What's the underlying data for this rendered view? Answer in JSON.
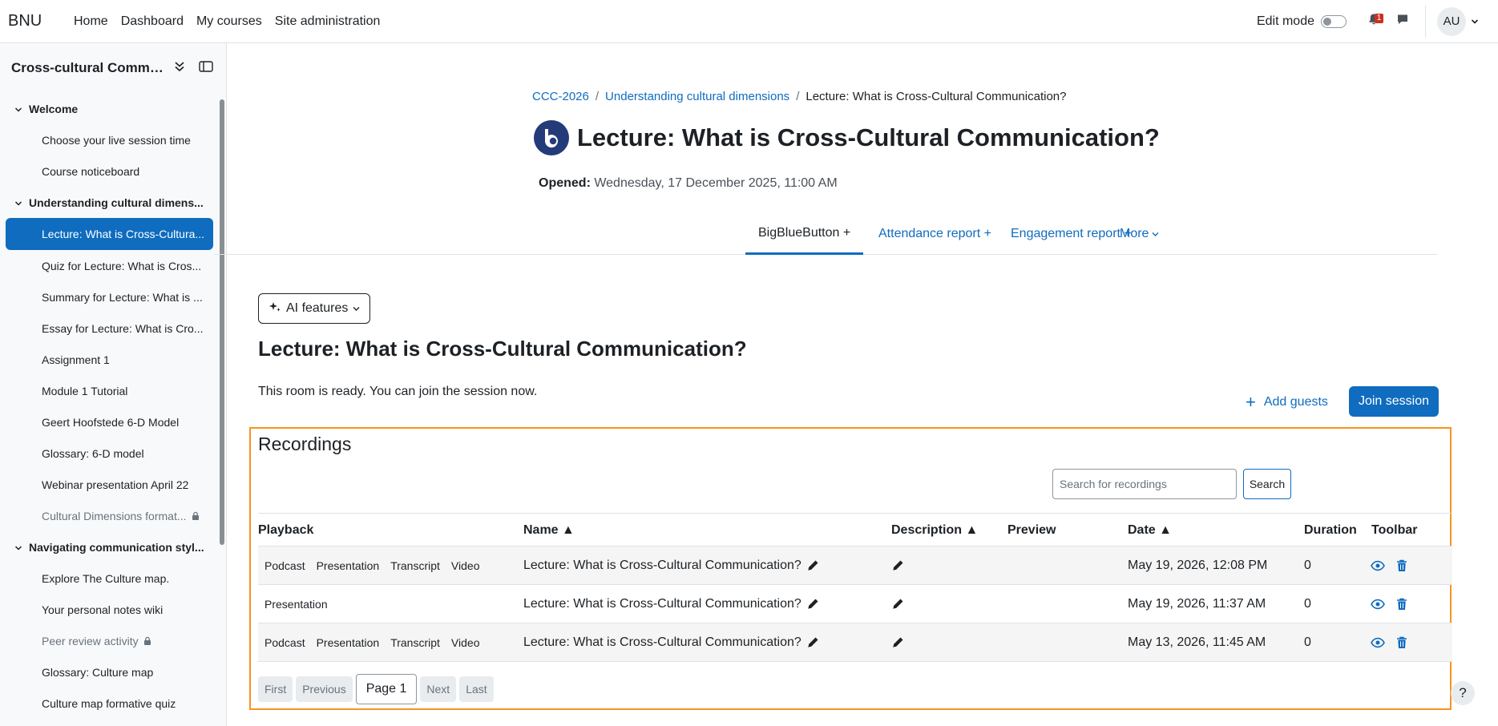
{
  "navbar": {
    "brand": "BNU",
    "links": [
      "Home",
      "Dashboard",
      "My courses",
      "Site administration"
    ],
    "edit_mode_label": "Edit mode",
    "notification_count": "1",
    "user_initials": "AU"
  },
  "sidebar": {
    "course_title": "Cross-cultural Commu...",
    "sections": [
      {
        "label": "Welcome",
        "items": [
          {
            "label": "Choose your live session time"
          },
          {
            "label": "Course noticeboard"
          }
        ]
      },
      {
        "label": "Understanding cultural dimens...",
        "items": [
          {
            "label": "Lecture: What is Cross-Cultura...",
            "active": true
          },
          {
            "label": "Quiz for Lecture: What is Cros..."
          },
          {
            "label": "Summary for Lecture: What is ..."
          },
          {
            "label": "Essay for Lecture: What is Cro..."
          },
          {
            "label": "Assignment 1"
          },
          {
            "label": "Module 1 Tutorial"
          },
          {
            "label": "Geert Hoofstede 6-D Model"
          },
          {
            "label": "Glossary: 6-D model"
          },
          {
            "label": "Webinar presentation April 22"
          },
          {
            "label": "Cultural Dimensions format...",
            "locked": true
          }
        ]
      },
      {
        "label": "Navigating communication styl...",
        "items": [
          {
            "label": "Explore The Culture map."
          },
          {
            "label": "Your personal notes wiki"
          },
          {
            "label": "Peer review activity",
            "locked": true
          },
          {
            "label": "Glossary: Culture map"
          },
          {
            "label": "Culture map formative quiz"
          }
        ]
      }
    ]
  },
  "breadcrumb": {
    "course": "CCC-2026",
    "section": "Understanding cultural dimensions",
    "current": "Lecture: What is Cross-Cultural Communication?"
  },
  "page": {
    "title": "Lecture: What is Cross-Cultural Communication?",
    "opened_label": "Opened:",
    "opened_value": "Wednesday, 17 December 2025, 11:00 AM"
  },
  "tabs": [
    "BigBlueButton +",
    "Attendance report +",
    "Engagement report +",
    "More"
  ],
  "activity": {
    "ai_features_label": "AI features",
    "title": "Lecture: What is Cross-Cultural Communication?",
    "room_status": "This room is ready. You can join the session now.",
    "add_guests_label": "Add guests",
    "join_label": "Join session"
  },
  "recordings": {
    "title": "Recordings",
    "search_placeholder": "Search for recordings",
    "search_label": "Search",
    "columns": [
      "Playback",
      "Name ▲",
      "Description ▲",
      "Preview",
      "Date ▲",
      "Duration",
      "Toolbar"
    ],
    "rows": [
      {
        "playback": [
          "Podcast",
          "Presentation",
          "Transcript",
          "Video"
        ],
        "name": "Lecture: What is Cross-Cultural Communication?",
        "date": "May 19, 2026, 12:08 PM",
        "duration": "0"
      },
      {
        "playback": [
          "Presentation"
        ],
        "name": "Lecture: What is Cross-Cultural Communication?",
        "date": "May 19, 2026, 11:37 AM",
        "duration": "0"
      },
      {
        "playback": [
          "Podcast",
          "Presentation",
          "Transcript",
          "Video"
        ],
        "name": "Lecture: What is Cross-Cultural Communication?",
        "date": "May 13, 2026, 11:45 AM",
        "duration": "0"
      }
    ],
    "pager": {
      "first": "First",
      "previous": "Previous",
      "current": "Page 1",
      "next": "Next",
      "last": "Last"
    }
  },
  "help_label": "?",
  "colors": {
    "accent": "#0f6cbf",
    "highlight_border": "#f7941d",
    "notification": "#ca3120",
    "bbb_logo": "#243b7a"
  }
}
